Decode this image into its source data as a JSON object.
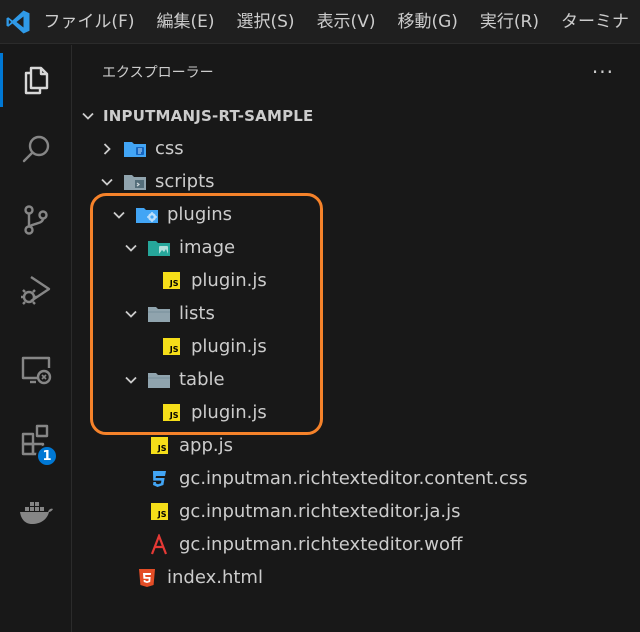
{
  "menu": [
    "ファイル(F)",
    "編集(E)",
    "選択(S)",
    "表示(V)",
    "移動(G)",
    "実行(R)",
    "ターミナ"
  ],
  "activity": {
    "extensions_badge": "1"
  },
  "explorer": {
    "title": "エクスプローラー",
    "more": "···",
    "section": "INPUTMANJS-RT-SAMPLE",
    "tree": [
      {
        "label": "css",
        "icon": "folder-css-icon",
        "state": "collapsed",
        "depth": 0
      },
      {
        "label": "scripts",
        "icon": "folder-scripts-icon",
        "state": "expanded",
        "depth": 0
      },
      {
        "label": "plugins",
        "icon": "folder-plugins-icon",
        "state": "expanded",
        "depth": 1
      },
      {
        "label": "image",
        "icon": "folder-image-icon",
        "state": "expanded",
        "depth": 2
      },
      {
        "label": "plugin.js",
        "icon": "js-file-icon",
        "state": "file",
        "depth": 3
      },
      {
        "label": "lists",
        "icon": "folder-icon",
        "state": "expanded",
        "depth": 2
      },
      {
        "label": "plugin.js",
        "icon": "js-file-icon",
        "state": "file",
        "depth": 3
      },
      {
        "label": "table",
        "icon": "folder-icon",
        "state": "expanded",
        "depth": 2
      },
      {
        "label": "plugin.js",
        "icon": "js-file-icon",
        "state": "file",
        "depth": 3
      },
      {
        "label": "app.js",
        "icon": "js-file-icon",
        "state": "file",
        "depth": 2
      },
      {
        "label": "gc.inputman.richtexteditor.content.css",
        "icon": "css-file-icon",
        "state": "file",
        "depth": 2
      },
      {
        "label": "gc.inputman.richtexteditor.ja.js",
        "icon": "js-file-icon",
        "state": "file",
        "depth": 2
      },
      {
        "label": "gc.inputman.richtexteditor.woff",
        "icon": "font-file-icon",
        "state": "file",
        "depth": 2
      },
      {
        "label": "index.html",
        "icon": "html-file-icon",
        "state": "file",
        "depth": 1
      }
    ],
    "js_badge_text": "JS"
  },
  "colors": {
    "accent": "#0078d4",
    "highlight": "#f5822a",
    "js": "#f5de19"
  }
}
